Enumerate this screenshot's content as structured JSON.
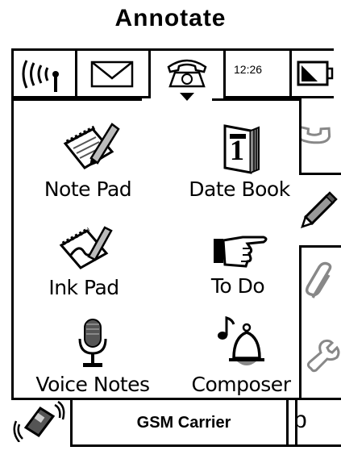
{
  "header": {
    "title": "Annotate"
  },
  "statusbar": {
    "time": "12:26"
  },
  "apps": [
    {
      "label": "Note Pad",
      "icon": "notepad-icon"
    },
    {
      "label": "Date Book",
      "icon": "datebook-icon"
    },
    {
      "label": "Ink Pad",
      "icon": "inkpad-icon"
    },
    {
      "label": "To Do",
      "icon": "pointing-hand-icon"
    },
    {
      "label": "Voice Notes",
      "icon": "microphone-icon"
    },
    {
      "label": "Composer",
      "icon": "bell-music-icon"
    }
  ],
  "tabs": [
    "phone-handset-icon",
    "pencil-icon",
    "paperclip-icon",
    "wrench-icon"
  ],
  "bottom": {
    "carrier": "GSM Carrier",
    "input_mode": "b"
  }
}
